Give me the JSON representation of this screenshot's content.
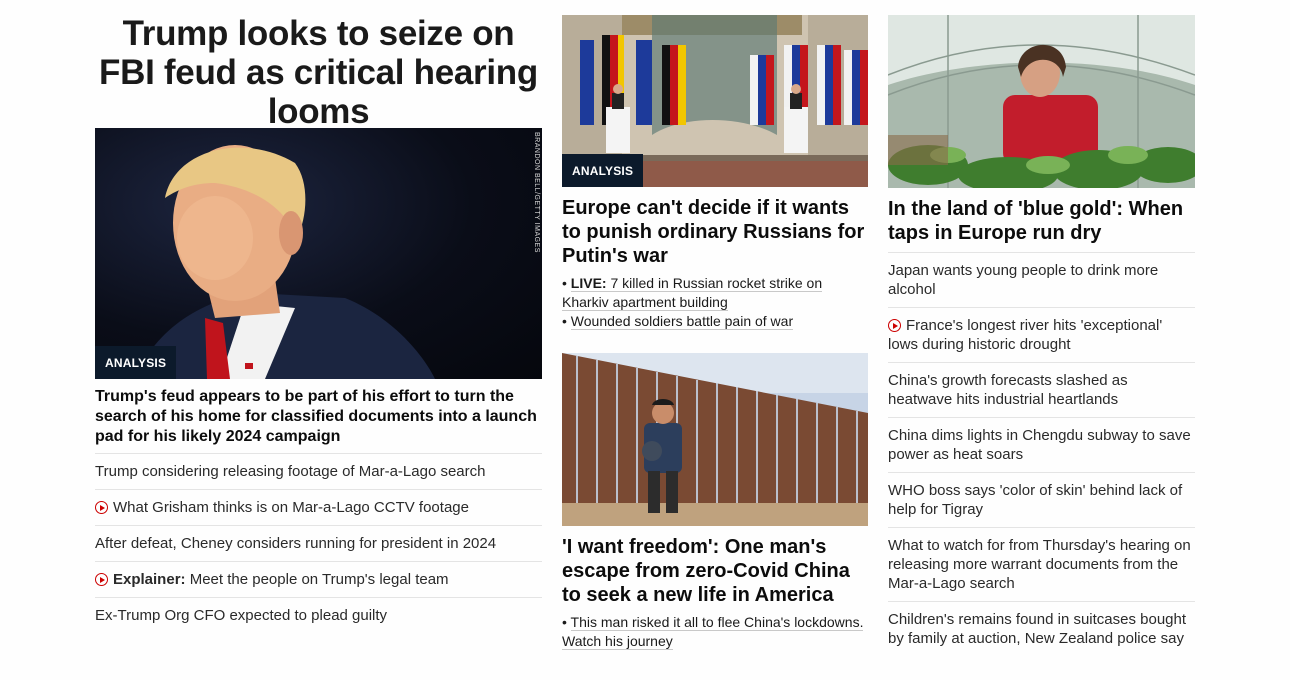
{
  "col1": {
    "title": "Trump looks to seize on FBI feud as critical hearing looms",
    "image": {
      "badge": "ANALYSIS",
      "credit": "BRANDON BELL/GETTY IMAGES"
    },
    "headline": "Trump's feud appears to be part of his effort to turn the search of his home for classified documents into a launch pad for his likely 2024 campaign",
    "items": [
      {
        "text": "Trump considering releasing footage of Mar-a-Lago search",
        "video": false
      },
      {
        "text": "What Grisham thinks is on Mar-a-Lago CCTV footage",
        "video": true
      },
      {
        "text": "After defeat, Cheney considers running for president in 2024",
        "video": false
      },
      {
        "prefix": "Explainer:",
        "text": "Meet the people on Trump's legal team",
        "video": true
      },
      {
        "text": "Ex-Trump Org CFO expected to plead guilty",
        "video": false
      }
    ]
  },
  "col2": {
    "story1": {
      "badge": "ANALYSIS",
      "headline": "Europe can't decide if it wants to punish ordinary Russians for Putin's war",
      "sub1_prefix": "LIVE:",
      "sub1_text": "7 killed in Russian rocket strike on Kharkiv apartment building",
      "sub2_text": "Wounded soldiers battle pain of war"
    },
    "story2": {
      "headline": "'I want freedom': One man's escape from zero-Covid China to seek a new life in America",
      "sub_text": "This man risked it all to flee China's lockdowns. Watch his journey"
    }
  },
  "col3": {
    "headline": "In the land of 'blue gold': When taps in Europe run dry",
    "items": [
      {
        "text": "Japan wants young people to drink more alcohol",
        "video": false
      },
      {
        "text": "France's longest river hits 'exceptional' lows during historic drought",
        "video": true
      },
      {
        "text": "China's growth forecasts slashed as heatwave hits industrial heartlands",
        "video": false
      },
      {
        "text": "China dims lights in Chengdu subway to save power as heat soars",
        "video": false
      },
      {
        "text": "WHO boss says 'color of skin' behind lack of help for Tigray",
        "video": false
      },
      {
        "text": "What to watch for from Thursday's hearing on releasing more warrant documents from the Mar-a-Lago search",
        "video": false
      },
      {
        "text": "Children's remains found in suitcases bought by family at auction, New Zealand police say",
        "video": false
      }
    ]
  },
  "colors": {
    "badge_bg": "#0c1a2b",
    "play_red": "#cc0000",
    "divider": "#e4e4e4"
  }
}
